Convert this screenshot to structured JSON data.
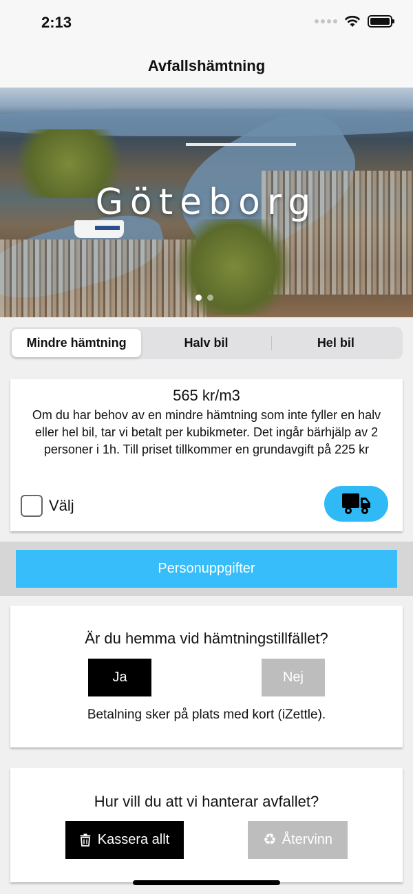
{
  "status_bar": {
    "time": "2:13"
  },
  "nav": {
    "title": "Avfallshämtning"
  },
  "hero": {
    "city_name": "Göteborg",
    "page_count": 2,
    "current_page": 1
  },
  "segments": {
    "items": [
      {
        "label": "Mindre hämtning",
        "selected": true
      },
      {
        "label": "Halv bil",
        "selected": false
      },
      {
        "label": "Hel bil",
        "selected": false
      }
    ]
  },
  "offer": {
    "price": "565 kr/m3",
    "description": "Om du har behov av en mindre hämtning som inte fyller en halv eller hel bil, tar vi betalt per kubikmeter. Det ingår bärhjälp av 2 personer i 1h. Till priset tillkommer en grundavgift på 225 kr",
    "choose_label": "Välj",
    "choose_checked": false,
    "truck_icon": "truck-icon"
  },
  "personal_button": {
    "label": "Personuppgifter"
  },
  "home_question": {
    "question": "Är du hemma vid hämtningstillfället?",
    "yes_label": "Ja",
    "no_label": "Nej",
    "selected": "yes",
    "payment_note": "Betalning sker på plats med kort (iZettle)."
  },
  "waste_question": {
    "question": "Hur vill du att vi hanterar avfallet?",
    "discard_label": "Kassera allt",
    "recycle_label": "Återvinn",
    "selected": "discard"
  },
  "colors": {
    "accent": "#36bdfa",
    "selected_button": "#000000",
    "unselected_button": "#bdbdbd"
  }
}
